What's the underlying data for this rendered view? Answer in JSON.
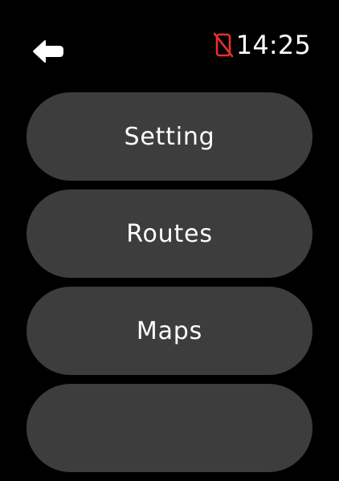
{
  "status": {
    "time": "14:25",
    "connectivity_icon": "phone-disconnected-icon",
    "connectivity_color": "#e5312b"
  },
  "navigation": {
    "back_icon": "back-arrow-icon"
  },
  "menu": {
    "items": [
      {
        "label": "Setting"
      },
      {
        "label": "Routes"
      },
      {
        "label": "Maps"
      },
      {
        "label": ""
      }
    ]
  },
  "colors": {
    "background": "#000000",
    "button_background": "#3d3d3d",
    "text": "#ffffff"
  }
}
